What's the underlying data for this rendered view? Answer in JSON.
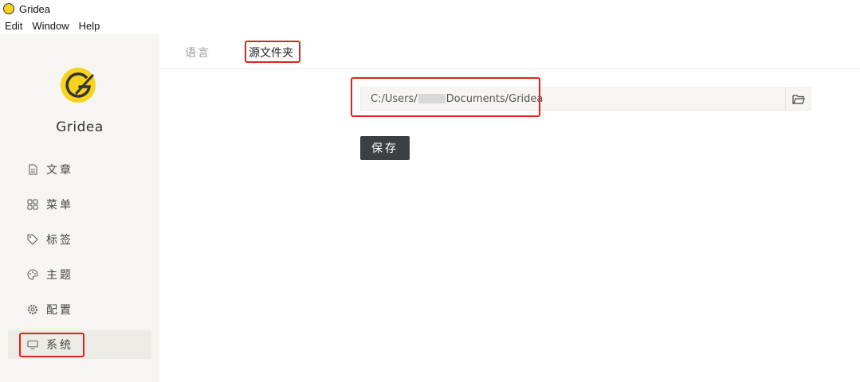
{
  "window": {
    "title": "Gridea"
  },
  "menu": [
    "Edit",
    "Window",
    "Help"
  ],
  "sidebar": {
    "brand": "Gridea",
    "items": [
      {
        "label": "文章",
        "icon": "document-icon"
      },
      {
        "label": "菜单",
        "icon": "grid-icon"
      },
      {
        "label": "标签",
        "icon": "tag-icon"
      },
      {
        "label": "主题",
        "icon": "palette-icon"
      },
      {
        "label": "配置",
        "icon": "gear-icon"
      },
      {
        "label": "系统",
        "icon": "monitor-icon",
        "active": true
      }
    ]
  },
  "tabs": [
    {
      "label": "语言"
    },
    {
      "label": "源文件夹",
      "active": true
    }
  ],
  "source_folder": {
    "path_prefix": "C:/Users/",
    "path_suffix": "Documents/Gridea"
  },
  "save_label": "保存",
  "colors": {
    "highlight": "#e0231b",
    "logo": "#f7d21e",
    "button": "#3c4043"
  }
}
